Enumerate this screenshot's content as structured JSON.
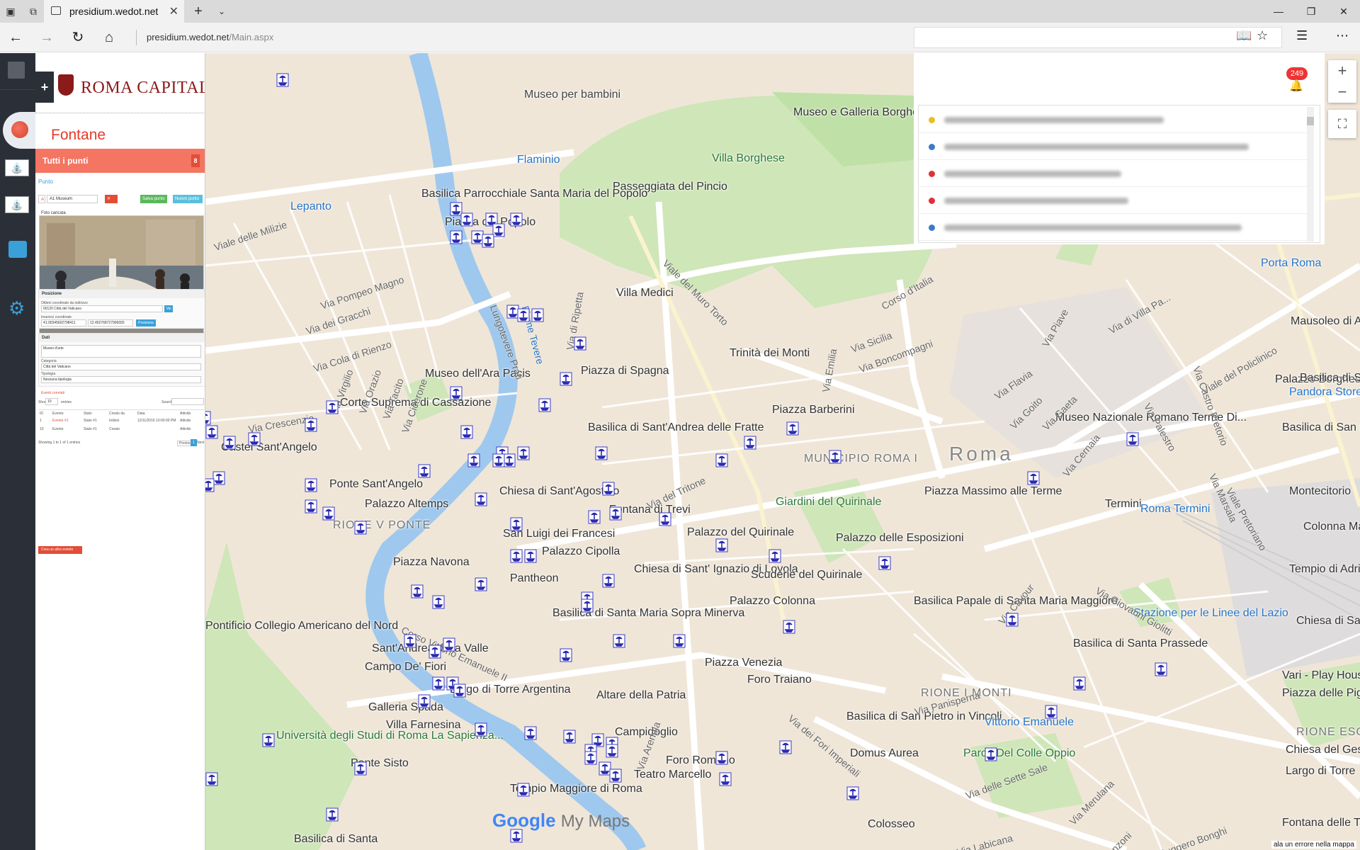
{
  "browser": {
    "tab_title": "presidium.wedot.net",
    "url_domain": "presidium.wedot.net",
    "url_path": "/Main.aspx"
  },
  "app": {
    "logo_text": "ROMA CAPITALE",
    "section_title": "Fontane",
    "filter_label": "Tutti i punti",
    "filter_count": "8",
    "punto_link": "Punto",
    "search_value": "A1 Museum",
    "btn_green": "Salva punto",
    "btn_blue": "Nuovo punto",
    "photo_label": "Foto caricata",
    "position_header": "Posizione",
    "address_label": "Ottieni coordinate da indirizzo",
    "address_value": "00120 Città del Vaticano",
    "address_btn": "Vai",
    "coords_label": "Inserisci coordinate",
    "lat_value": "41.90345602798411",
    "lng_value": "12.452768727906555",
    "coords_btn": "Posiziona",
    "data_header": "Dati",
    "name_value": "Museo d'arte",
    "category_label": "Categoria",
    "category_value": "Città del Vaticano",
    "type_label": "Tipologia",
    "type_value": "Nessuna tipologia",
    "events_label": "Eventi correlati",
    "show_label": "Show",
    "show_value": "10",
    "entries_label": "entries",
    "search_label": "Search:",
    "table_headers": [
      "ID",
      "Evento",
      "Stato",
      "Creato da",
      "Data",
      "Attività"
    ],
    "table_rows": [
      [
        "1",
        "Evento #1",
        "Stato #1",
        "Indizio",
        "12/11/2016 10:00:00 PM",
        "Attività"
      ],
      [
        "10",
        "Evento",
        "Stato #1",
        "Creato",
        "",
        "Attività"
      ]
    ],
    "table_info": "Showing 1 to 1 of 1 entries",
    "prev_label": "Previous",
    "page_label": "1",
    "next_label": "Next",
    "red_btn": "Crea un altro evento"
  },
  "results_panel": {
    "badge": "249",
    "rows": [
      {
        "color": "#e8c020"
      },
      {
        "color": "#3a7bc8"
      },
      {
        "color": "#e0303a"
      },
      {
        "color": "#e0303a"
      },
      {
        "color": "#3a7bc8"
      }
    ]
  },
  "map": {
    "labels": [
      "Museo per bambini",
      "Museo e Galleria Borghese",
      "Villa Borghese",
      "Flaminio",
      "Passeggiata del Pincio",
      "Basilica Parrocchiale Santa Maria del Popolo",
      "Piazza del Popolo",
      "Lepanto",
      "Villa Medici",
      "Trinità dei Monti",
      "Piazza di Spagna",
      "Museo dell'Ara Pacis",
      "Corte Suprema di Cassazione",
      "Castel Sant'Angelo",
      "Basilica di Sant'Andrea delle Fratte",
      "Piazza Barberini",
      "MUNICIPIO ROMA I",
      "Roma",
      "Museo Nazionale Romano Terme Di...",
      "Piazza Massimo alle Terme",
      "Termini",
      "Roma Termini",
      "Ponte Sant'Angelo",
      "Chiesa di Sant'Agostino",
      "Fontana di Trevi",
      "Palazzo Altemps",
      "RIONE V PONTE",
      "San Luigi dei Francesi",
      "Palazzo del Quirinale",
      "Giardini del Quirinale",
      "Palazzo delle Esposizioni",
      "Piazza Navona",
      "Palazzo Cipolla",
      "Pantheon",
      "Chiesa di Sant' Ignazio di Loyola",
      "Scuderie del Quirinale",
      "Palazzo Colonna",
      "Basilica Papale di Santa Maria Maggiore",
      "Stazione per le Linee del Lazio",
      "Pontificio Collegio Americano del Nord",
      "Basilica di Santa Maria Sopra Minerva",
      "Sant'Andrea della Valle",
      "Campo De' Fiori",
      "Piazza Venezia",
      "Foro Traiano",
      "Basilica di Santa Prassede",
      "Largo di Torre Argentina",
      "Altare della Patria",
      "RIONE I MONTI",
      "Galleria Spada",
      "Villa Farnesina",
      "Campidoglio",
      "Basilica di San Pietro in Vincoli",
      "Vittorio Emanuele",
      "Università degli Studi di Roma La Sapienza...",
      "Ponte Sisto",
      "Foro Romano",
      "Domus Aurea",
      "Parco Del Colle Oppio",
      "Teatro Marcello",
      "Colosseo",
      "Tempio Maggiore di Roma",
      "Basilica di Santa",
      "Vari - Play House",
      "Piazza delle Pigna",
      "Largo di Torre",
      "Palazzo Borghese",
      "Pandora Store",
      "Mausoleo di Augusto",
      "Basilica di San Lorenzo in Lucina",
      "Tempio di Adriano",
      "Fontana delle Tartarughe",
      "Chiesa di Sant'Ignazio di Loyola",
      "Basilica di San Carlo al...",
      "Montecitorio",
      "Colonna Marco Aurelio",
      "Chiesa del Gesù",
      "RIONE ESQ",
      "Porta Roma"
    ],
    "streets": [
      "Viale delle Milizie",
      "Via Pompeo Magno",
      "Via dei Gracchi",
      "Via Cola di Rienzo",
      "Via Crescenzio",
      "Via Virgilio",
      "Via Orazio",
      "Via Tacito",
      "Via Cicerone",
      "Lungotevere Prati",
      "Fiume Tevere",
      "Via di Ripetta",
      "Viale del Muro Torto",
      "Via Sicilia",
      "Via Boncompagni",
      "Via Emilia",
      "Corso d'Italia",
      "Via Piave",
      "Via Flavia",
      "Via Goito",
      "Via Gaeta",
      "Via Castro Pretorio",
      "Via Cernaia",
      "Via Palestro",
      "Via Marsala",
      "Viale del Policlinico",
      "Via di Villa Pa...",
      "Via del Tritone",
      "Via Cavour",
      "Via Giovanni Giolitti",
      "Viale Pretoriano",
      "Via Panisperna",
      "Via dei Fori Imperiali",
      "Via delle Sette Sale",
      "Via Labicana",
      "Via Merulana",
      "Corso Vittorio Emanuele II",
      "Via Arenula",
      "Via Ruggero Bonghi",
      "Viale Manzoni"
    ],
    "google_text": "Google",
    "mymaps_text": "My Maps",
    "error_text": "ala un errore nella mappa"
  }
}
